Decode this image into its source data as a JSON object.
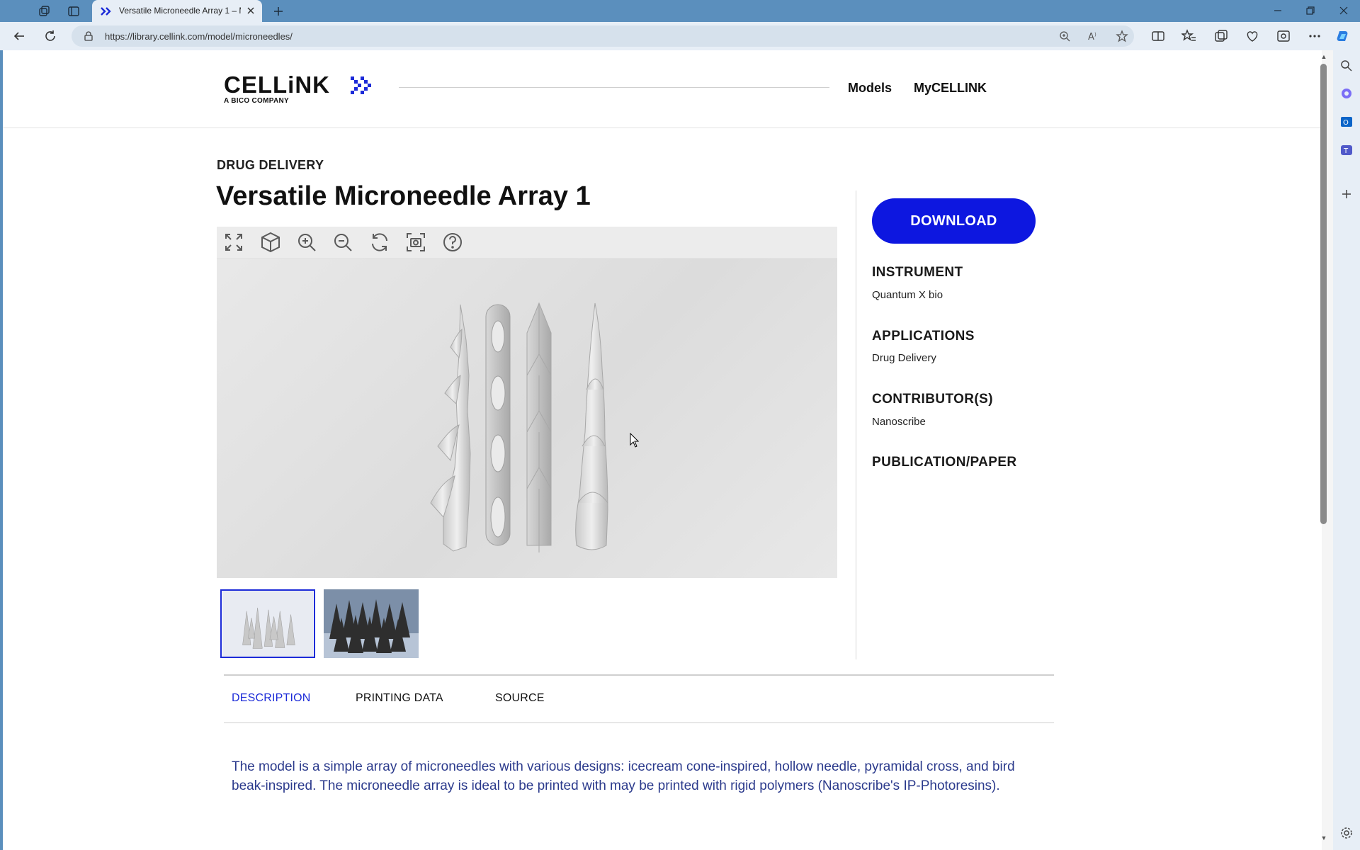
{
  "browser": {
    "tab_title": "Versatile Microneedle Array 1 – M",
    "url": "https://library.cellink.com/model/microneedles/"
  },
  "site": {
    "logo_text": "CELLiNK",
    "logo_sub": "A BICO COMPANY",
    "nav": [
      "Models",
      "MyCELLINK"
    ]
  },
  "model": {
    "category": "DRUG DELIVERY",
    "title": "Versatile Microneedle Array 1",
    "download_label": "DOWNLOAD",
    "instrument_label": "INSTRUMENT",
    "instrument": "Quantum X bio",
    "applications_label": "APPLICATIONS",
    "applications": "Drug Delivery",
    "contributors_label": "CONTRIBUTOR(S)",
    "contributors": "Nanoscribe",
    "publication_label": "PUBLICATION/PAPER"
  },
  "viewer": {
    "tools": [
      "fullscreen-icon",
      "cube-view-icon",
      "zoom-in-icon",
      "zoom-out-icon",
      "rotate-icon",
      "screenshot-icon",
      "help-icon"
    ]
  },
  "tabs": [
    "DESCRIPTION",
    "PRINTING DATA",
    "SOURCE"
  ],
  "active_tab": "DESCRIPTION",
  "description": "The model is a simple array of microneedles with various designs: icecream cone-inspired, hollow needle, pyramidal cross, and bird beak-inspired. The microneedle array is ideal to be printed with may be printed with rigid polymers (Nanoscribe's IP-Photoresins).",
  "colors": {
    "accent": "#0d17e0",
    "tab_active": "#1c2bd8"
  }
}
